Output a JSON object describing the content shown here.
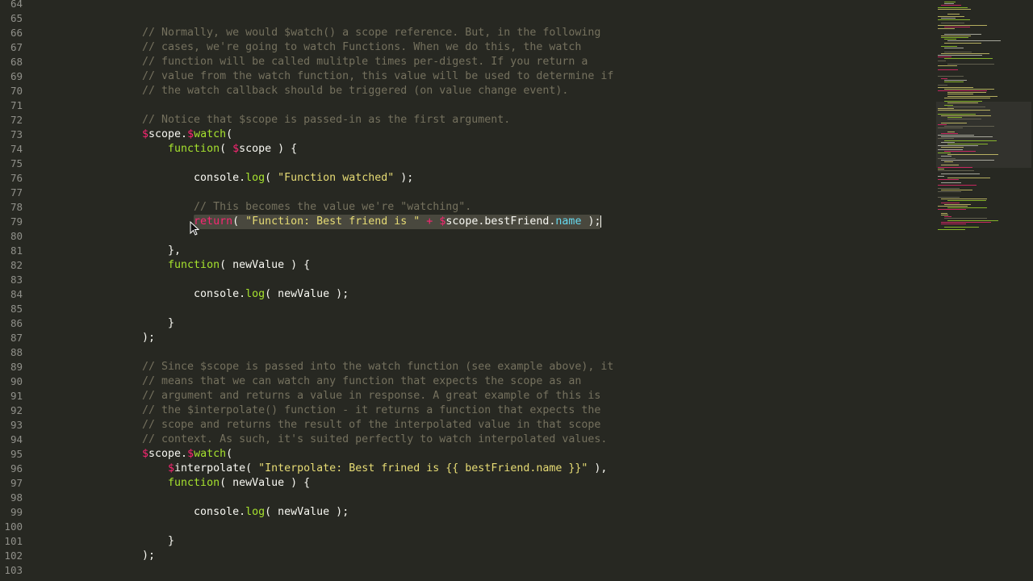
{
  "gutter": {
    "line_numbers": [
      "64",
      "65",
      "66",
      "67",
      "68",
      "69",
      "70",
      "71",
      "72",
      "73",
      "74",
      "75",
      "76",
      "77",
      "78",
      "79",
      "80",
      "81",
      "82",
      "83",
      "84",
      "85",
      "86",
      "87",
      "88",
      "89",
      "90",
      "91",
      "92",
      "93",
      "94",
      "95",
      "96",
      "97",
      "98",
      "99",
      "100",
      "101",
      "102",
      "103"
    ]
  },
  "code": {
    "lines": [
      {
        "indent": "",
        "tokens": []
      },
      {
        "indent": "",
        "tokens": []
      },
      {
        "indent": "",
        "tokens": [
          {
            "t": "c-comment",
            "v": "// Normally, we would $watch() a scope reference. But, in the following"
          }
        ]
      },
      {
        "indent": "",
        "tokens": [
          {
            "t": "c-comment",
            "v": "// cases, we're going to watch Functions. When we do this, the watch"
          }
        ]
      },
      {
        "indent": "",
        "tokens": [
          {
            "t": "c-comment",
            "v": "// function will be called mulitple times per-digest. If you return a"
          }
        ]
      },
      {
        "indent": "",
        "tokens": [
          {
            "t": "c-comment",
            "v": "// value from the watch function, this value will be used to determine if"
          }
        ]
      },
      {
        "indent": "",
        "tokens": [
          {
            "t": "c-comment",
            "v": "// the watch callback should be triggered (on value change event)."
          }
        ]
      },
      {
        "indent": "",
        "tokens": []
      },
      {
        "indent": "",
        "tokens": [
          {
            "t": "c-comment",
            "v": "// Notice that $scope is passed-in as the first argument."
          }
        ]
      },
      {
        "indent": "",
        "tokens": [
          {
            "t": "c-dollar",
            "v": "$"
          },
          {
            "t": "c-plain",
            "v": "scope."
          },
          {
            "t": "c-dollar",
            "v": "$"
          },
          {
            "t": "c-fn",
            "v": "watch"
          },
          {
            "t": "c-plain",
            "v": "("
          }
        ]
      },
      {
        "indent": "    ",
        "tokens": [
          {
            "t": "c-fn",
            "v": "function"
          },
          {
            "t": "c-plain",
            "v": "( "
          },
          {
            "t": "c-dollar",
            "v": "$"
          },
          {
            "t": "c-plain",
            "v": "scope ) {"
          }
        ]
      },
      {
        "indent": "",
        "tokens": []
      },
      {
        "indent": "        ",
        "tokens": [
          {
            "t": "c-plain",
            "v": "console."
          },
          {
            "t": "c-fn",
            "v": "log"
          },
          {
            "t": "c-plain",
            "v": "( "
          },
          {
            "t": "c-str",
            "v": "\"Function watched\""
          },
          {
            "t": "c-plain",
            "v": " );"
          }
        ]
      },
      {
        "indent": "",
        "tokens": []
      },
      {
        "indent": "        ",
        "tokens": [
          {
            "t": "c-comment",
            "v": "// This becomes the value we're \"watching\"."
          }
        ]
      },
      {
        "indent": "        ",
        "selected": true,
        "tokens": [
          {
            "t": "c-kw",
            "v": "return"
          },
          {
            "t": "c-plain",
            "v": "( "
          },
          {
            "t": "c-str",
            "v": "\"Function: Best friend is \""
          },
          {
            "t": "c-plain",
            "v": " "
          },
          {
            "t": "c-kw",
            "v": "+"
          },
          {
            "t": "c-plain",
            "v": " "
          },
          {
            "t": "c-dollar",
            "v": "$"
          },
          {
            "t": "c-plain",
            "v": "scope.bestFriend."
          },
          {
            "t": "c-prop",
            "v": "name"
          },
          {
            "t": "c-plain",
            "v": " );"
          }
        ]
      },
      {
        "indent": "",
        "tokens": []
      },
      {
        "indent": "    ",
        "tokens": [
          {
            "t": "c-plain",
            "v": "},"
          }
        ]
      },
      {
        "indent": "    ",
        "tokens": [
          {
            "t": "c-fn",
            "v": "function"
          },
          {
            "t": "c-plain",
            "v": "( newValue ) {"
          }
        ]
      },
      {
        "indent": "",
        "tokens": []
      },
      {
        "indent": "        ",
        "tokens": [
          {
            "t": "c-plain",
            "v": "console."
          },
          {
            "t": "c-fn",
            "v": "log"
          },
          {
            "t": "c-plain",
            "v": "( newValue );"
          }
        ]
      },
      {
        "indent": "",
        "tokens": []
      },
      {
        "indent": "    ",
        "tokens": [
          {
            "t": "c-plain",
            "v": "}"
          }
        ]
      },
      {
        "indent": "",
        "tokens": [
          {
            "t": "c-plain",
            "v": ");"
          }
        ]
      },
      {
        "indent": "",
        "tokens": []
      },
      {
        "indent": "",
        "tokens": [
          {
            "t": "c-comment",
            "v": "// Since $scope is passed into the watch function (see example above), it"
          }
        ]
      },
      {
        "indent": "",
        "tokens": [
          {
            "t": "c-comment",
            "v": "// means that we can watch any function that expects the scope as an"
          }
        ]
      },
      {
        "indent": "",
        "tokens": [
          {
            "t": "c-comment",
            "v": "// argument and returns a value in response. A great example of this is"
          }
        ]
      },
      {
        "indent": "",
        "tokens": [
          {
            "t": "c-comment",
            "v": "// the $interpolate() function - it returns a function that expects the"
          }
        ]
      },
      {
        "indent": "",
        "tokens": [
          {
            "t": "c-comment",
            "v": "// scope and returns the result of the interpolated value in that scope"
          }
        ]
      },
      {
        "indent": "",
        "tokens": [
          {
            "t": "c-comment",
            "v": "// context. As such, it's suited perfectly to watch interpolated values."
          }
        ]
      },
      {
        "indent": "",
        "tokens": [
          {
            "t": "c-dollar",
            "v": "$"
          },
          {
            "t": "c-plain",
            "v": "scope."
          },
          {
            "t": "c-dollar",
            "v": "$"
          },
          {
            "t": "c-fn",
            "v": "watch"
          },
          {
            "t": "c-plain",
            "v": "("
          }
        ]
      },
      {
        "indent": "    ",
        "tokens": [
          {
            "t": "c-dollar",
            "v": "$"
          },
          {
            "t": "c-plain",
            "v": "interpolate( "
          },
          {
            "t": "c-str",
            "v": "\"Interpolate: Best frined is {{ bestFriend.name }}\""
          },
          {
            "t": "c-plain",
            "v": " ),"
          }
        ]
      },
      {
        "indent": "    ",
        "tokens": [
          {
            "t": "c-fn",
            "v": "function"
          },
          {
            "t": "c-plain",
            "v": "( newValue ) {"
          }
        ]
      },
      {
        "indent": "",
        "tokens": []
      },
      {
        "indent": "        ",
        "tokens": [
          {
            "t": "c-plain",
            "v": "console."
          },
          {
            "t": "c-fn",
            "v": "log"
          },
          {
            "t": "c-plain",
            "v": "( newValue );"
          }
        ]
      },
      {
        "indent": "",
        "tokens": []
      },
      {
        "indent": "    ",
        "tokens": [
          {
            "t": "c-plain",
            "v": "}"
          }
        ]
      },
      {
        "indent": "",
        "tokens": [
          {
            "t": "c-plain",
            "v": ");"
          }
        ]
      },
      {
        "indent": "",
        "tokens": []
      }
    ]
  },
  "colors": {
    "background": "#272822",
    "comment": "#75715e",
    "keyword": "#f92672",
    "function": "#a6e22e",
    "string": "#e6db74",
    "property": "#66d9ef",
    "selection": "#49483e"
  },
  "icons": {
    "mouse_cursor": "arrow-cursor-icon"
  }
}
